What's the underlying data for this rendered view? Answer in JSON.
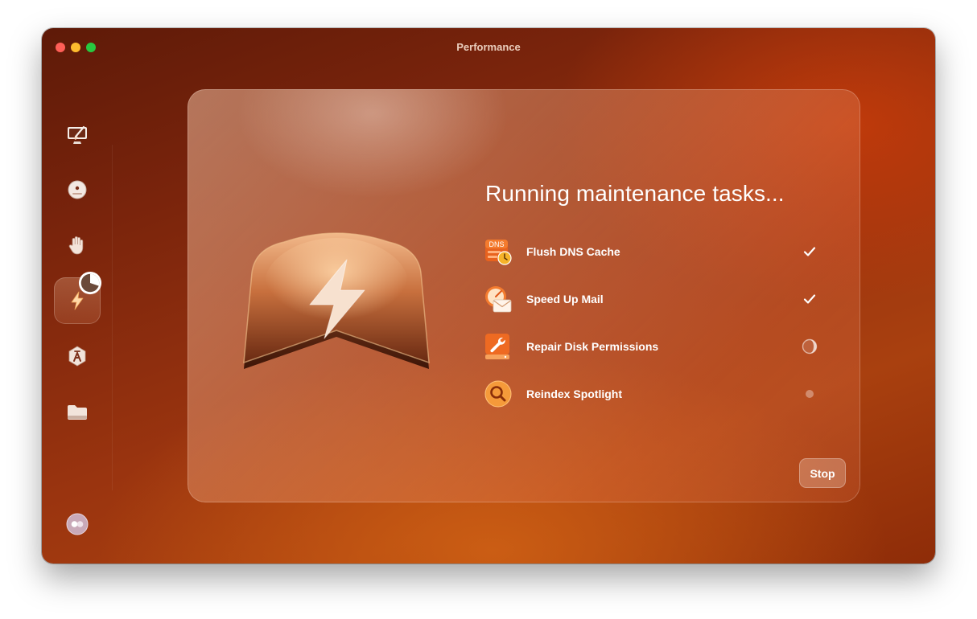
{
  "window": {
    "title": "Performance"
  },
  "colors": {
    "accent": "#c2410c",
    "text": "#ffffff",
    "traffic_close": "#ff5f57",
    "traffic_minimize": "#febc2e",
    "traffic_maximize": "#28c840"
  },
  "sidebar": {
    "items": [
      {
        "icon": "monitor-broom-icon",
        "active": false
      },
      {
        "icon": "shield-disk-icon",
        "active": false
      },
      {
        "icon": "privacy-hand-icon",
        "active": false
      },
      {
        "icon": "performance-bolt-icon",
        "active": true,
        "progress": 0.3
      },
      {
        "icon": "applications-icon",
        "active": false
      },
      {
        "icon": "folder-icon",
        "active": false
      }
    ],
    "footer_icon": "assistant-icon"
  },
  "main": {
    "heading": "Running maintenance tasks...",
    "hero_icon": "performance-bolt-shield-icon",
    "tasks": [
      {
        "label": "Flush DNS Cache",
        "icon": "dns-icon",
        "icon_text": "DNS",
        "status": "done"
      },
      {
        "label": "Speed Up Mail",
        "icon": "mail-speed-icon",
        "status": "done"
      },
      {
        "label": "Repair Disk Permissions",
        "icon": "disk-wrench-icon",
        "status": "running"
      },
      {
        "label": "Reindex Spotlight",
        "icon": "spotlight-search-icon",
        "status": "pending"
      }
    ],
    "stop_label": "Stop"
  }
}
